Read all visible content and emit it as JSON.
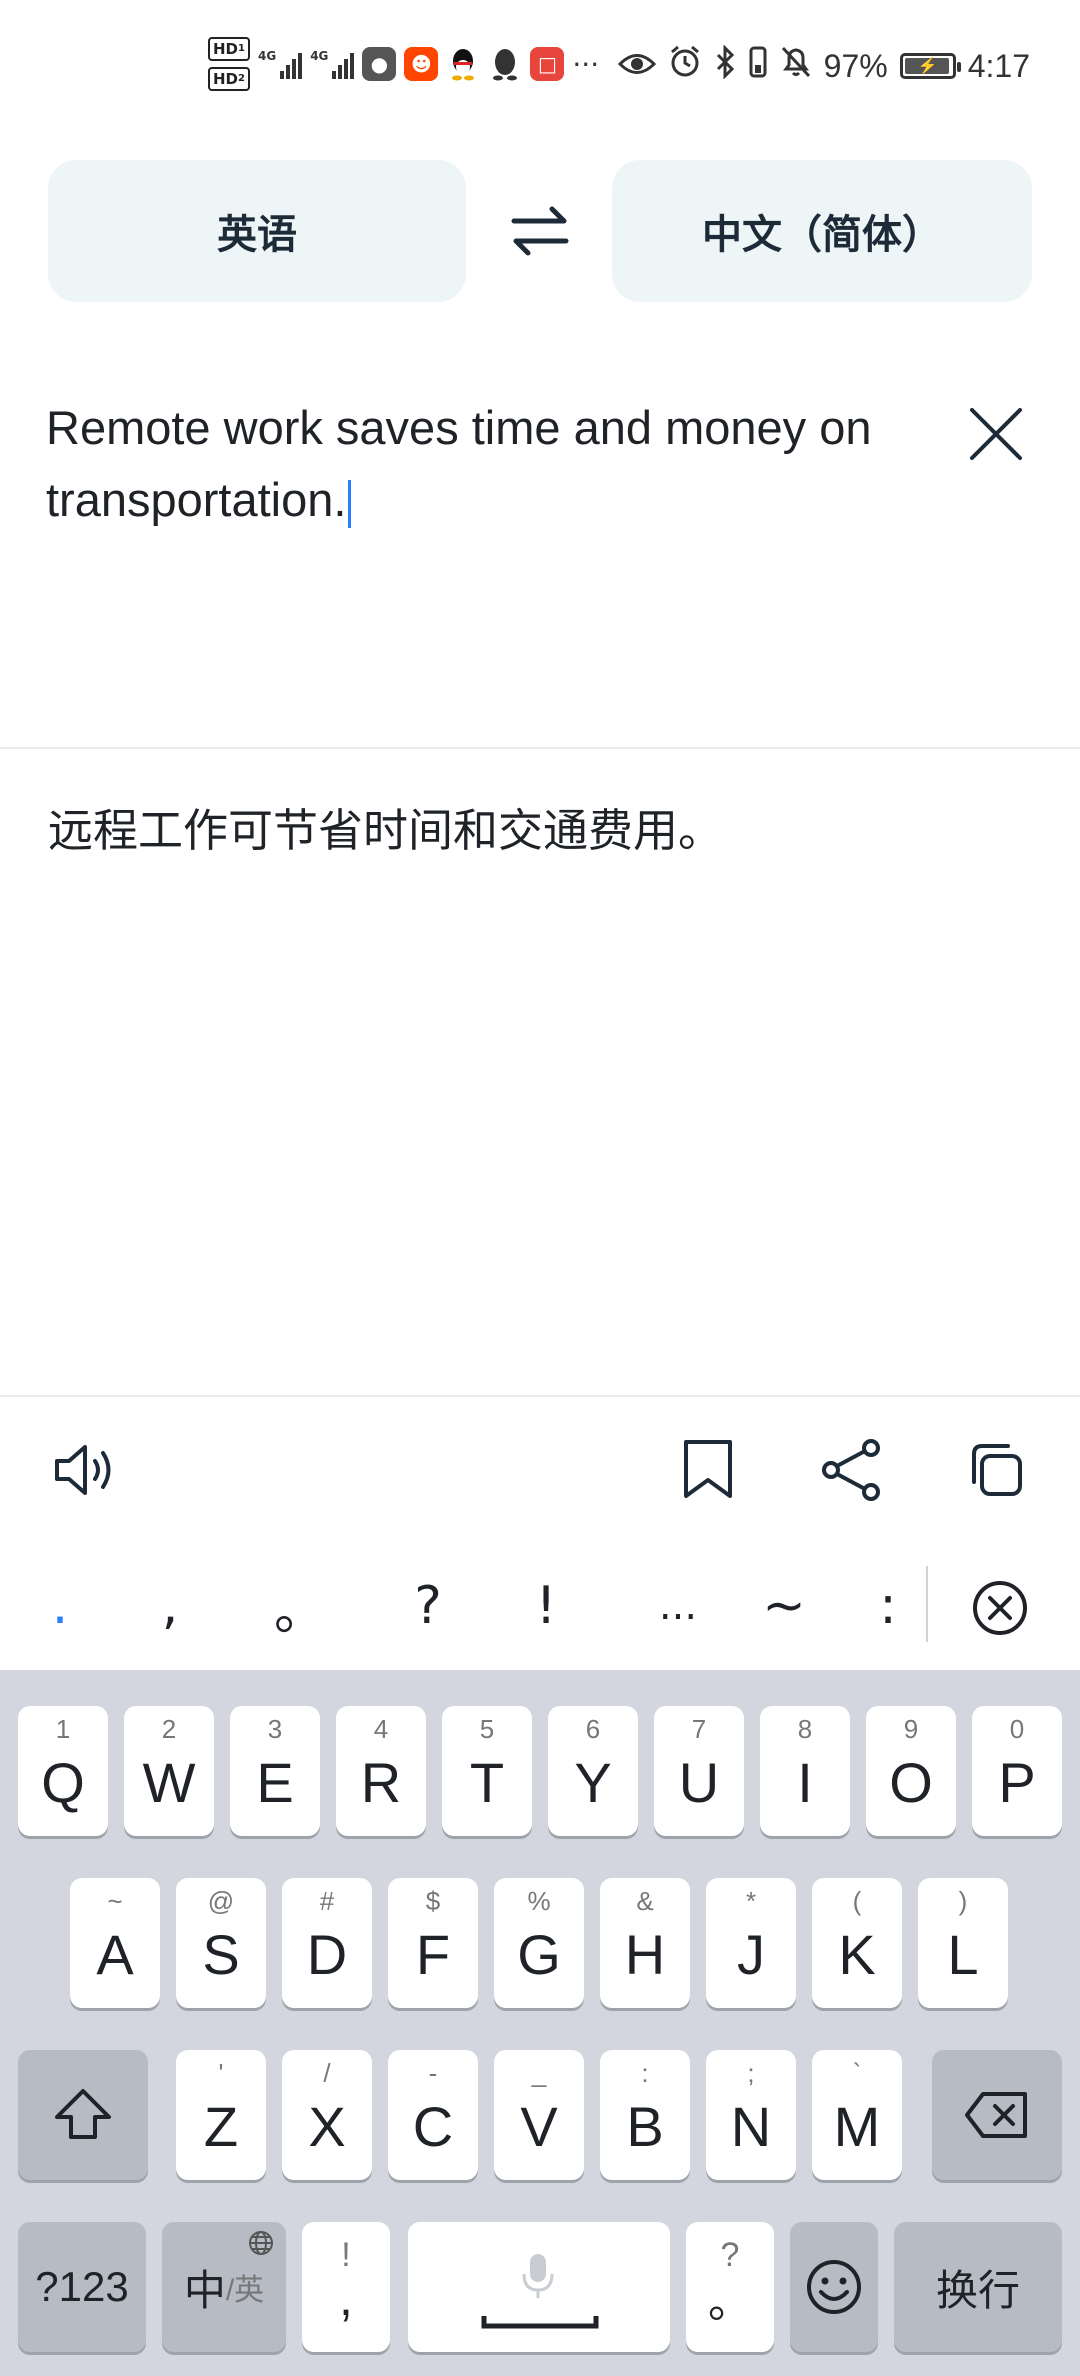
{
  "status_bar": {
    "hd1": "HD",
    "hd2": "HD",
    "sim1_network": "4G",
    "sim2_network": "4G",
    "more": "···",
    "battery_percent": "97%",
    "battery_level": 0.97,
    "time": "4:17",
    "icons": [
      "hd-sim1-icon",
      "hd-sim2-icon",
      "signal-sim1-icon",
      "signal-sim2-icon",
      "game-app-icon",
      "reddit-app-icon",
      "qq-app-icon",
      "qq-outline-app-icon",
      "book-app-icon",
      "eye-icon",
      "alarm-icon",
      "bluetooth-icon",
      "vibrate-icon",
      "mute-icon",
      "battery-icon"
    ]
  },
  "translator": {
    "source_lang": "英语",
    "target_lang": "中文（简体）",
    "input_text": "Remote work saves time and money on transportation.",
    "output_text": "远程工作可节省时间和交通费用。"
  },
  "actions": [
    "speaker-icon",
    "bookmark-icon",
    "share-icon",
    "copy-icon"
  ],
  "punctuation": [
    ".",
    ",",
    "。",
    "?",
    "!",
    "...",
    "~",
    ":"
  ],
  "keyboard": {
    "row1": [
      {
        "key": "Q",
        "hint": "1"
      },
      {
        "key": "W",
        "hint": "2"
      },
      {
        "key": "E",
        "hint": "3"
      },
      {
        "key": "R",
        "hint": "4"
      },
      {
        "key": "T",
        "hint": "5"
      },
      {
        "key": "Y",
        "hint": "6"
      },
      {
        "key": "U",
        "hint": "7"
      },
      {
        "key": "I",
        "hint": "8"
      },
      {
        "key": "O",
        "hint": "9"
      },
      {
        "key": "P",
        "hint": "0"
      }
    ],
    "row2": [
      {
        "key": "A",
        "hint": "~"
      },
      {
        "key": "S",
        "hint": "@"
      },
      {
        "key": "D",
        "hint": "#"
      },
      {
        "key": "F",
        "hint": "$"
      },
      {
        "key": "G",
        "hint": "%"
      },
      {
        "key": "H",
        "hint": "&"
      },
      {
        "key": "J",
        "hint": "*"
      },
      {
        "key": "K",
        "hint": "("
      },
      {
        "key": "L",
        "hint": ")"
      }
    ],
    "row3": [
      {
        "key": "Z",
        "hint": "'"
      },
      {
        "key": "X",
        "hint": "/"
      },
      {
        "key": "C",
        "hint": "-"
      },
      {
        "key": "V",
        "hint": "_"
      },
      {
        "key": "B",
        "hint": ":"
      },
      {
        "key": "N",
        "hint": ";"
      },
      {
        "key": "M",
        "hint": "`"
      }
    ],
    "symbols_label": "?123",
    "lang_main": "中",
    "lang_sub": "/英",
    "comma_main": ",",
    "comma_hint": "!",
    "period_main": "。",
    "period_hint": "?",
    "enter_label": "换行"
  }
}
